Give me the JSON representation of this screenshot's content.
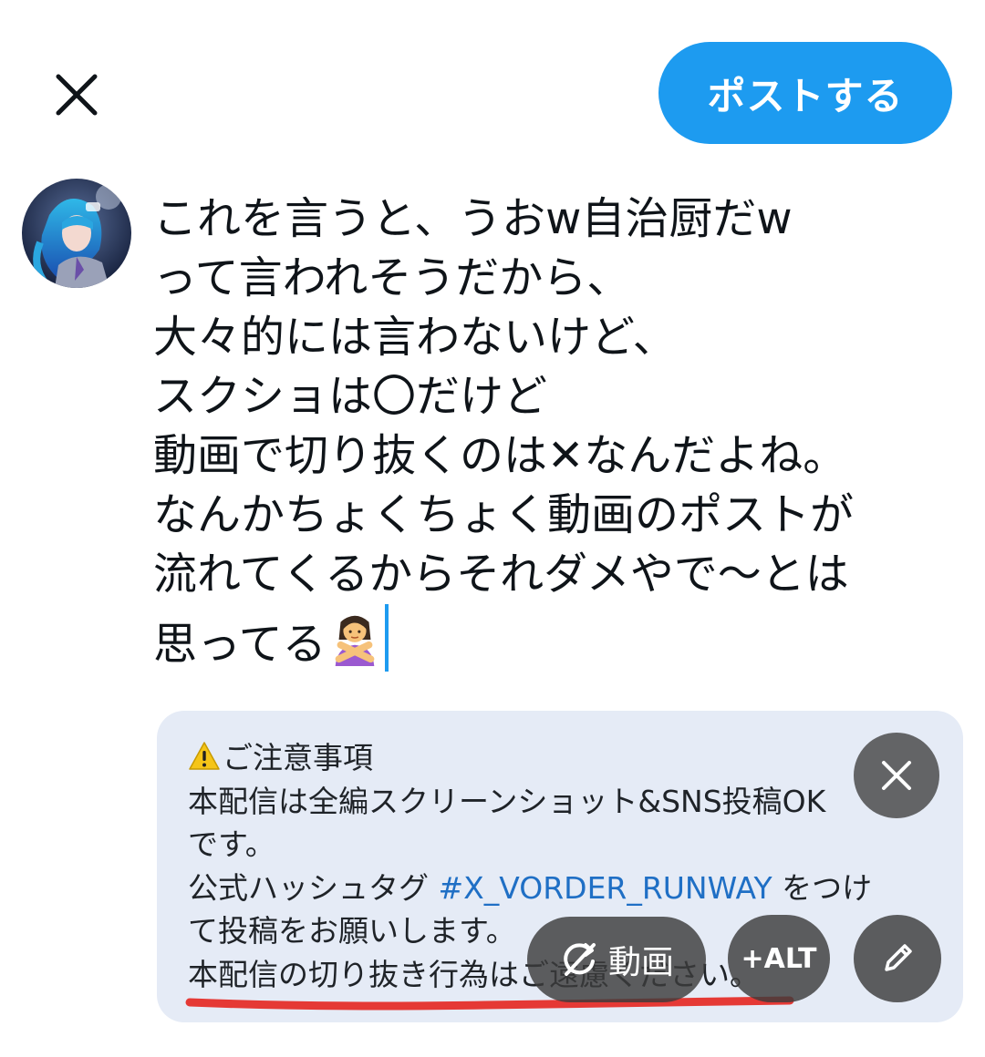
{
  "header": {
    "close_icon": "close-icon",
    "post_label": "ポストする",
    "post_color": "#1d9bf0"
  },
  "compose": {
    "lines": [
      "これを言うと、うおw自治厨だw",
      "って言われそうだから、",
      "大々的には言わないけど、",
      "スクショは〇だけど",
      "動画で切り抜くのは✕なんだよね。",
      "なんかちょくちょく動画のポストが",
      "流れてくるからそれダメやで〜とは",
      "思ってる"
    ],
    "trailing_emoji": "person-gesturing-no-icon"
  },
  "media": {
    "notice": {
      "title": "ご注意事項",
      "line1": "本配信は全編スクリーンショット&SNS投稿OK",
      "line2": "です。",
      "line3_prefix": "公式ハッシュタグ ",
      "hashtag": "#X_VORDER_RUNWAY",
      "line3_suffix": " をつけ",
      "line4": "て投稿をお願いします。",
      "line5": "本配信の切り抜き行為はご遠慮ください。"
    },
    "video_label": "動画",
    "alt_label": "+ALT",
    "accent_red": "#e53935"
  }
}
